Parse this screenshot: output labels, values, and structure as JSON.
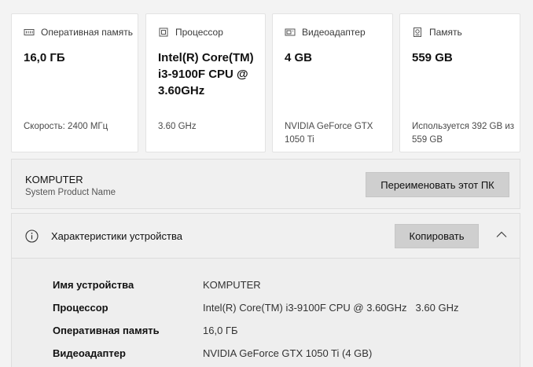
{
  "cards": [
    {
      "icon": "ram-icon",
      "title": "Оперативная память",
      "value": "16,0 ГБ",
      "sub": "Скорость: 2400 МГц"
    },
    {
      "icon": "cpu-icon",
      "title": "Процессор",
      "value": "Intel(R) Core(TM) i3-9100F CPU @ 3.60GHz",
      "sub": "3.60 GHz"
    },
    {
      "icon": "gpu-icon",
      "title": "Видеоадаптер",
      "value": "4 GB",
      "sub": "NVIDIA GeForce GTX 1050 Ti"
    },
    {
      "icon": "storage-icon",
      "title": "Память",
      "value": "559 GB",
      "sub": "Используется 392 GB из 559 GB"
    }
  ],
  "rename": {
    "pc_name": "KOMPUTER",
    "pc_sub": "System Product Name",
    "button": "Переименовать этот ПК"
  },
  "specs": {
    "title": "Характеристики устройства",
    "copy_button": "Копировать",
    "rows": [
      {
        "label": "Имя устройства",
        "value": "KOMPUTER",
        "extra": ""
      },
      {
        "label": "Процессор",
        "value": "Intel(R) Core(TM) i3-9100F CPU @ 3.60GHz",
        "extra": "3.60 GHz"
      },
      {
        "label": "Оперативная память",
        "value": "16,0 ГБ",
        "extra": ""
      },
      {
        "label": "Видеоадаптер",
        "value": "NVIDIA GeForce GTX 1050 Ti (4 GB)",
        "extra": ""
      }
    ]
  }
}
